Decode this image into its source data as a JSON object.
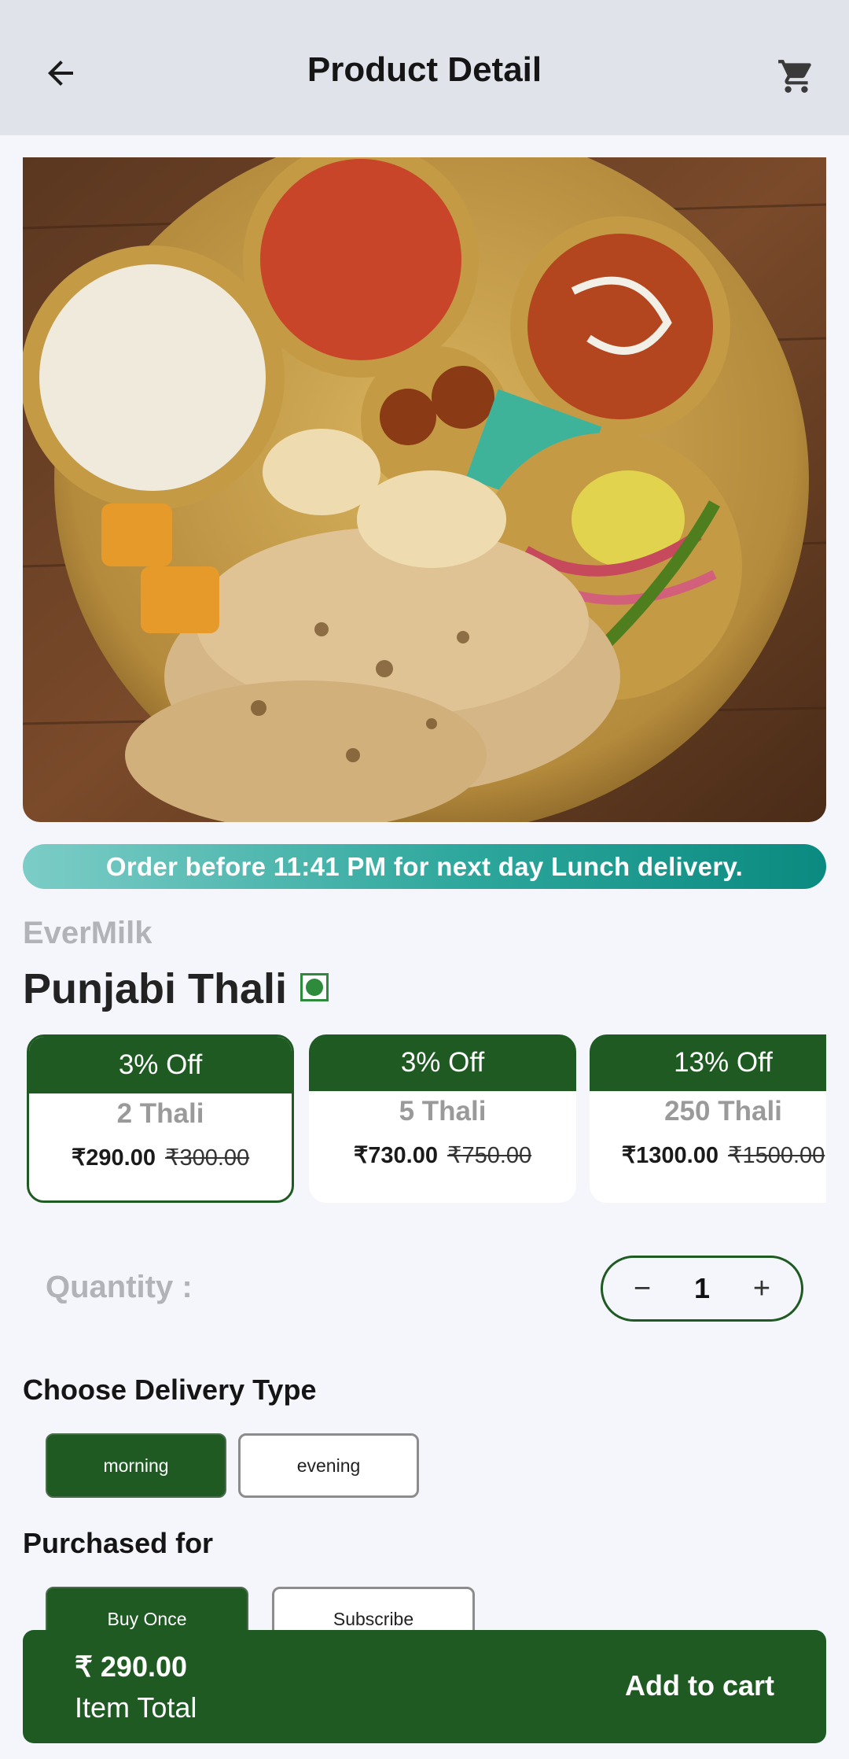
{
  "header": {
    "title": "Product Detail",
    "back_icon": "arrow-left-icon",
    "cart_icon": "shopping-cart-icon"
  },
  "banner": {
    "text": "Order before 11:41 PM for next day Lunch delivery."
  },
  "product": {
    "brand": "EverMilk",
    "name": "Punjabi Thali",
    "veg_indicator": "veg-icon"
  },
  "packs": [
    {
      "off": "3% Off",
      "name": "2 Thali",
      "price": "₹290.00",
      "mrp": "₹300.00",
      "selected": true
    },
    {
      "off": "3% Off",
      "name": "5 Thali",
      "price": "₹730.00",
      "mrp": "₹750.00",
      "selected": false
    },
    {
      "off": "13% Off",
      "name": "250 Thali",
      "price": "₹1300.00",
      "mrp": "₹1500.00",
      "selected": false
    }
  ],
  "quantity": {
    "label": "Quantity :",
    "value": "1",
    "minus": "−",
    "plus": "+"
  },
  "delivery": {
    "title": "Choose Delivery Type",
    "options": [
      "morning",
      "evening"
    ],
    "selected": "morning"
  },
  "purchase": {
    "title": "Purchased for",
    "options": [
      "Buy Once",
      "Subscribe"
    ],
    "selected": "Buy Once"
  },
  "footer": {
    "total": "₹ 290.00",
    "total_label": "Item Total",
    "cta": "Add to cart"
  },
  "colors": {
    "primary": "#1e5a22",
    "appbar": "#e1e3ea",
    "background": "#f5f6fb",
    "banner_start": "#7ccdc7",
    "banner_end": "#0a8a80"
  }
}
